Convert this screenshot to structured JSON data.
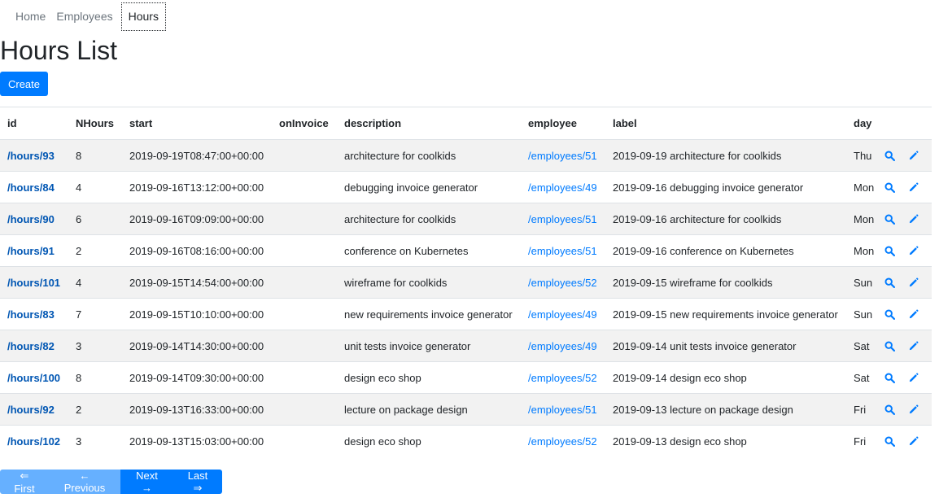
{
  "breadcrumb": {
    "home": "Home",
    "employees": "Employees",
    "hours": "Hours"
  },
  "page": {
    "title": "Hours List",
    "create_label": "Create"
  },
  "table": {
    "headers": {
      "id": "id",
      "nhours": "NHours",
      "start": "start",
      "oninvoice": "onInvoice",
      "description": "description",
      "employee": "employee",
      "label": "label",
      "day": "day"
    },
    "rows": [
      {
        "id": "/hours/93",
        "nhours": "8",
        "start": "2019-09-19T08:47:00+00:00",
        "oninvoice": "",
        "description": "architecture for coolkids",
        "employee": "/employees/51",
        "label": "2019-09-19 architecture for coolkids",
        "day": "Thu"
      },
      {
        "id": "/hours/84",
        "nhours": "4",
        "start": "2019-09-16T13:12:00+00:00",
        "oninvoice": "",
        "description": "debugging invoice generator",
        "employee": "/employees/49",
        "label": "2019-09-16 debugging invoice generator",
        "day": "Mon"
      },
      {
        "id": "/hours/90",
        "nhours": "6",
        "start": "2019-09-16T09:09:00+00:00",
        "oninvoice": "",
        "description": "architecture for coolkids",
        "employee": "/employees/51",
        "label": "2019-09-16 architecture for coolkids",
        "day": "Mon"
      },
      {
        "id": "/hours/91",
        "nhours": "2",
        "start": "2019-09-16T08:16:00+00:00",
        "oninvoice": "",
        "description": "conference on Kubernetes",
        "employee": "/employees/51",
        "label": "2019-09-16 conference on Kubernetes",
        "day": "Mon"
      },
      {
        "id": "/hours/101",
        "nhours": "4",
        "start": "2019-09-15T14:54:00+00:00",
        "oninvoice": "",
        "description": "wireframe for coolkids",
        "employee": "/employees/52",
        "label": "2019-09-15 wireframe for coolkids",
        "day": "Sun"
      },
      {
        "id": "/hours/83",
        "nhours": "7",
        "start": "2019-09-15T10:10:00+00:00",
        "oninvoice": "",
        "description": "new requirements invoice generator",
        "employee": "/employees/49",
        "label": "2019-09-15 new requirements invoice generator",
        "day": "Sun"
      },
      {
        "id": "/hours/82",
        "nhours": "3",
        "start": "2019-09-14T14:30:00+00:00",
        "oninvoice": "",
        "description": "unit tests invoice generator",
        "employee": "/employees/49",
        "label": "2019-09-14 unit tests invoice generator",
        "day": "Sat"
      },
      {
        "id": "/hours/100",
        "nhours": "8",
        "start": "2019-09-14T09:30:00+00:00",
        "oninvoice": "",
        "description": "design eco shop",
        "employee": "/employees/52",
        "label": "2019-09-14 design eco shop",
        "day": "Sat"
      },
      {
        "id": "/hours/92",
        "nhours": "2",
        "start": "2019-09-13T16:33:00+00:00",
        "oninvoice": "",
        "description": "lecture on package design",
        "employee": "/employees/51",
        "label": "2019-09-13 lecture on package design",
        "day": "Fri"
      },
      {
        "id": "/hours/102",
        "nhours": "3",
        "start": "2019-09-13T15:03:00+00:00",
        "oninvoice": "",
        "description": "design eco shop",
        "employee": "/employees/52",
        "label": "2019-09-13 design eco shop",
        "day": "Fri"
      }
    ],
    "actions": {
      "show_icon": "search-icon",
      "edit_icon": "pencil-icon",
      "icon_color": "#007bff"
    }
  },
  "pagination": {
    "first": "⇐ First",
    "previous": "← Previous",
    "next": "Next →",
    "last": "Last ⇒"
  },
  "colors": {
    "primary": "#007bff",
    "primary_disabled": "#66b0ff",
    "stripe": "#f2f2f2",
    "link_bold": "#0056b3"
  }
}
